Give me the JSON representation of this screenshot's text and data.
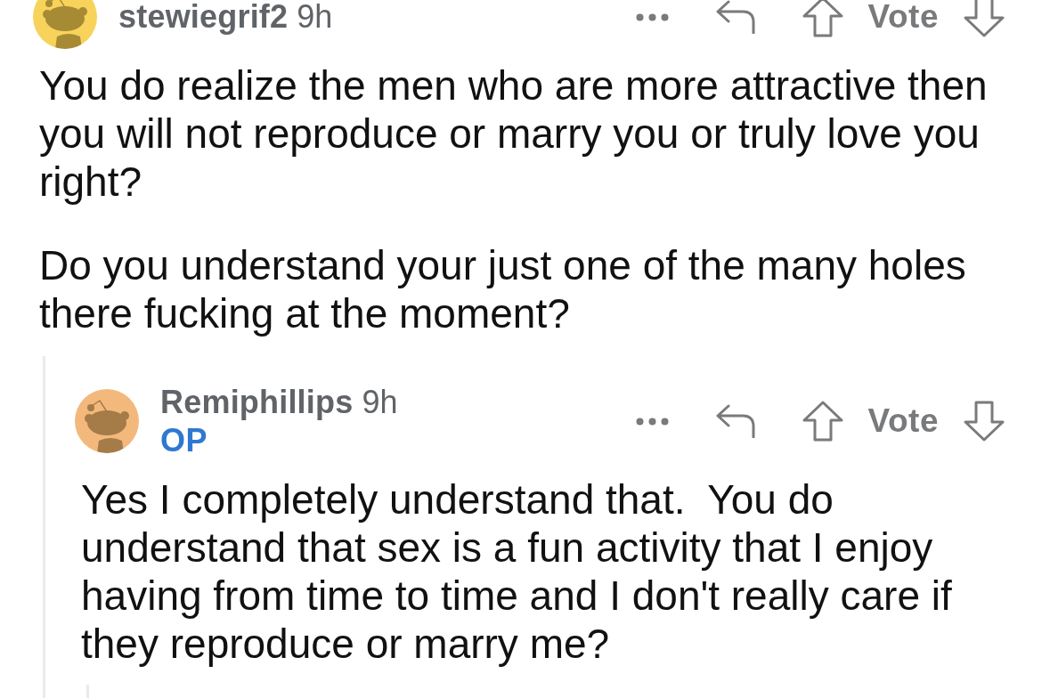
{
  "comments": [
    {
      "author": "stewiegrif2",
      "time": "9h",
      "color": "#f7d35b",
      "vote_label": "Vote",
      "paragraphs": [
        "You do realize the men who are more attractive then you will not reproduce or marry you or truly love you right?",
        "Do you understand your just one of the many holes there fucking at the moment?"
      ],
      "replies": [
        {
          "author": "Remiphillips",
          "time": "9h",
          "badge": "OP",
          "color": "#f3b87c",
          "vote_label": "Vote",
          "paragraphs": [
            "Yes I completely understand that.  You do understand that sex is a fun activity that I enjoy having from time to time and I don't really care if they reproduce or marry me?"
          ],
          "more_replies": true
        }
      ]
    }
  ]
}
